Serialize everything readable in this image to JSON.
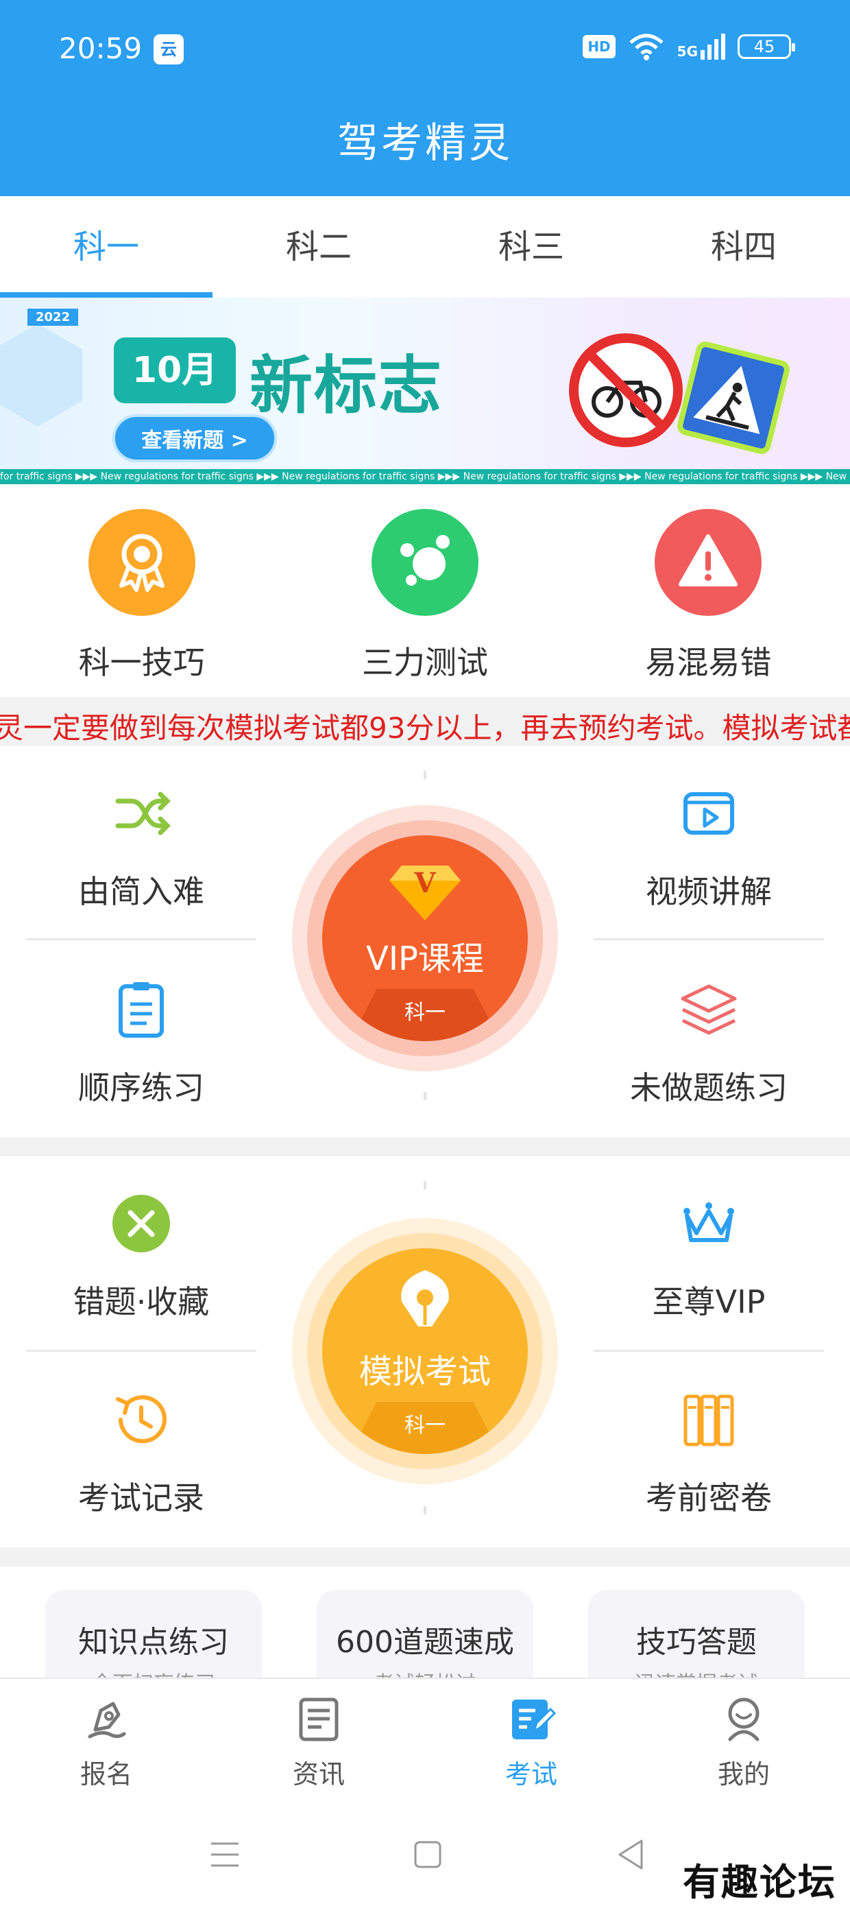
{
  "status_bar": {
    "time": "20:59",
    "app_icon_label": "云",
    "hd": "HD",
    "signal": "5G",
    "battery": "45"
  },
  "header": {
    "title": "驾考精灵"
  },
  "tabs": [
    {
      "label": "科一",
      "active": true
    },
    {
      "label": "科二",
      "active": false
    },
    {
      "label": "科三",
      "active": false
    },
    {
      "label": "科四",
      "active": false
    }
  ],
  "banner": {
    "year": "2022",
    "month": "10月",
    "headline": "新标志",
    "button": "查看新题 >",
    "ticker": "for traffic signs    ▶▶▶    New regulations for traffic signs    ▶▶▶    New regulations for traffic signs    ▶▶▶    New regulations for traffic signs    ▶▶▶    New regulations for traffic signs    ▶▶▶    New regulations for traffic signs"
  },
  "quick_actions": [
    {
      "label": "科一技巧",
      "icon": "medal-icon",
      "color": "#ffa726"
    },
    {
      "label": "三力测试",
      "icon": "bubbles-icon",
      "color": "#2ecc71"
    },
    {
      "label": "易混易错",
      "icon": "warning-icon",
      "color": "#f15b5b"
    }
  ],
  "marquee": "灵一定要做到每次模拟考试都93分以上，再去预约考试。模拟考试都",
  "panel1": {
    "top_left": {
      "label": "由简入难",
      "icon": "shuffle-icon"
    },
    "top_right": {
      "label": "视频讲解",
      "icon": "video-icon"
    },
    "bottom_left": {
      "label": "顺序练习",
      "icon": "clipboard-icon"
    },
    "bottom_right": {
      "label": "未做题练习",
      "icon": "layers-icon"
    },
    "center": {
      "title": "VIP课程",
      "subtitle": "科一",
      "badge": "V"
    }
  },
  "panel2": {
    "top_left": {
      "label": "错题·收藏",
      "icon": "close-circle-icon"
    },
    "top_right": {
      "label": "至尊VIP",
      "icon": "crown-icon"
    },
    "bottom_left": {
      "label": "考试记录",
      "icon": "history-icon"
    },
    "bottom_right": {
      "label": "考前密卷",
      "icon": "binders-icon"
    },
    "center": {
      "title": "模拟考试",
      "subtitle": "科一"
    }
  },
  "cards": [
    {
      "title": "知识点练习",
      "subtitle": "全面扫盲练习"
    },
    {
      "title": "600道题速成",
      "subtitle": "考试轻松过"
    },
    {
      "title": "技巧答题",
      "subtitle": "迅速掌握考试"
    }
  ],
  "bottom_nav": [
    {
      "label": "报名",
      "icon": "pen-icon",
      "active": false
    },
    {
      "label": "资讯",
      "icon": "news-icon",
      "active": false
    },
    {
      "label": "考试",
      "icon": "exam-icon",
      "active": true
    },
    {
      "label": "我的",
      "icon": "user-icon",
      "active": false
    }
  ],
  "watermark": "有趣论坛"
}
